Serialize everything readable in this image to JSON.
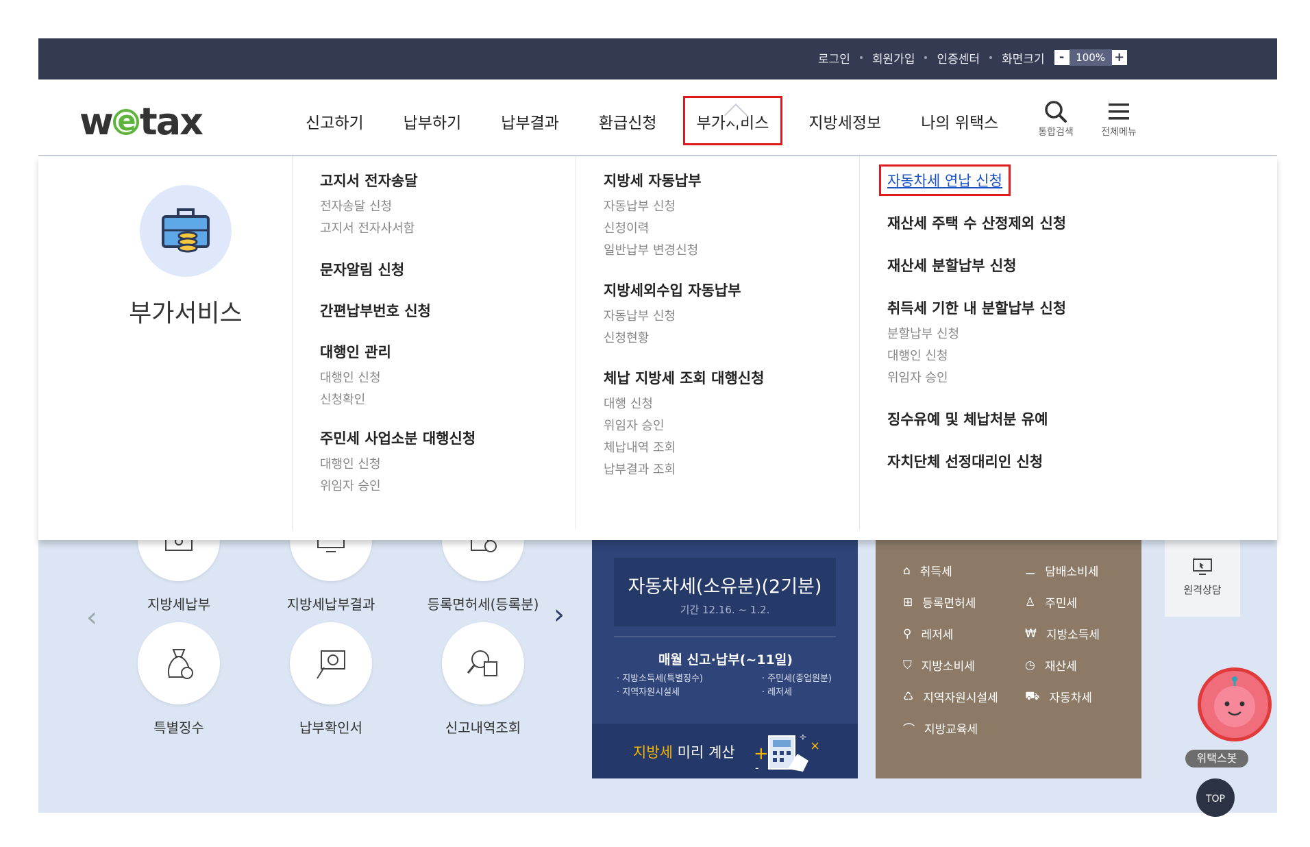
{
  "util": {
    "links": [
      "로그인",
      "회원가입",
      "인증센터"
    ],
    "screen_size_label": "화면크기",
    "zoom_minus": "-",
    "zoom_value": "100%",
    "zoom_plus": "+"
  },
  "header": {
    "logo_w": "w",
    "logo_e": "e",
    "logo_tax": "tax",
    "nav": [
      "신고하기",
      "납부하기",
      "납부결과",
      "환급신청",
      "부가서비스",
      "지방세정보",
      "나의 위택스"
    ],
    "search_label": "통합검색",
    "menu_label": "전체메뉴"
  },
  "mega": {
    "title": "부가서비스",
    "col1": [
      {
        "title": "고지서 전자송달",
        "subs": [
          "전자송달 신청",
          "고지서 전자사서함"
        ]
      },
      {
        "title": "문자알림 신청",
        "subs": []
      },
      {
        "title": "간편납부번호 신청",
        "subs": []
      },
      {
        "title": "대행인 관리",
        "subs": [
          "대행인 신청",
          "신청확인"
        ]
      },
      {
        "title": "주민세 사업소분 대행신청",
        "subs": [
          "대행인 신청",
          "위임자 승인"
        ]
      }
    ],
    "col2": [
      {
        "title": "지방세 자동납부",
        "subs": [
          "자동납부 신청",
          "신청이력",
          "일반납부 변경신청"
        ]
      },
      {
        "title": "지방세외수입 자동납부",
        "subs": [
          "자동납부 신청",
          "신청현황"
        ]
      },
      {
        "title": "체납 지방세 조회 대행신청",
        "subs": [
          "대행 신청",
          "위임자 승인",
          "체납내역 조회",
          "납부결과 조회"
        ]
      }
    ],
    "col3": [
      {
        "title": "자동차세 연납 신청",
        "subs": []
      },
      {
        "title": "재산세 주택 수 산정제외 신청",
        "subs": []
      },
      {
        "title": "재산세 분할납부 신청",
        "subs": []
      },
      {
        "title": "취득세 기한 내 분할납부 신청",
        "subs": [
          "분할납부 신청",
          "대행인 신청",
          "위임자 승인"
        ]
      },
      {
        "title": "징수유예 및 체납처분 유예",
        "subs": []
      },
      {
        "title": "자치단체 선정대리인 신청",
        "subs": []
      }
    ]
  },
  "services": [
    "지방세납부",
    "지방세납부결과",
    "등록면허세(등록분)",
    "특별징수",
    "납부확인서",
    "신고내역조회"
  ],
  "banner": {
    "title": "자동차세(소유분)(2기분)",
    "period": "기간 12.16. ~ 1.2.",
    "monthly": "매월 신고·납부(~11일)",
    "list_left": [
      "· 지방소득세(특별징수)",
      "· 지역자원시설세"
    ],
    "list_right": [
      "· 주민세(종업원분)",
      "· 레저세"
    ],
    "calc_orange": "지방세",
    "calc_rest": " 미리 계산"
  },
  "taxes": [
    "취득세",
    "담배소비세",
    "등록면허세",
    "주민세",
    "레저세",
    "지방소득세",
    "지방소비세",
    "재산세",
    "지역자원시설세",
    "자동차세",
    "지방교육세"
  ],
  "right": {
    "remote": "원격상담",
    "bot": "위택스봇",
    "top": "TOP"
  }
}
